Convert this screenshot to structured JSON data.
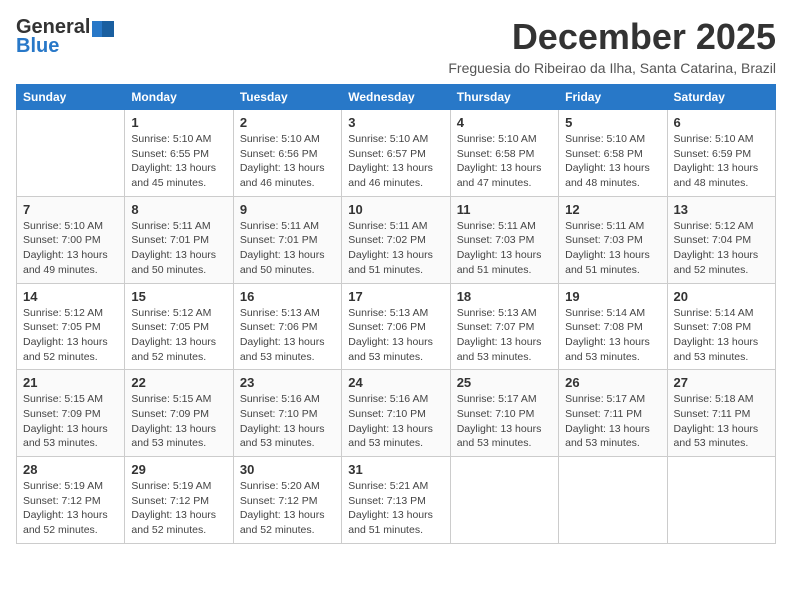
{
  "header": {
    "logo_line1": "General",
    "logo_line2": "Blue",
    "month_title": "December 2025",
    "subtitle": "Freguesia do Ribeirao da Ilha, Santa Catarina, Brazil"
  },
  "columns": [
    "Sunday",
    "Monday",
    "Tuesday",
    "Wednesday",
    "Thursday",
    "Friday",
    "Saturday"
  ],
  "weeks": [
    [
      {
        "day": "",
        "info": ""
      },
      {
        "day": "1",
        "info": "Sunrise: 5:10 AM\nSunset: 6:55 PM\nDaylight: 13 hours\nand 45 minutes."
      },
      {
        "day": "2",
        "info": "Sunrise: 5:10 AM\nSunset: 6:56 PM\nDaylight: 13 hours\nand 46 minutes."
      },
      {
        "day": "3",
        "info": "Sunrise: 5:10 AM\nSunset: 6:57 PM\nDaylight: 13 hours\nand 46 minutes."
      },
      {
        "day": "4",
        "info": "Sunrise: 5:10 AM\nSunset: 6:58 PM\nDaylight: 13 hours\nand 47 minutes."
      },
      {
        "day": "5",
        "info": "Sunrise: 5:10 AM\nSunset: 6:58 PM\nDaylight: 13 hours\nand 48 minutes."
      },
      {
        "day": "6",
        "info": "Sunrise: 5:10 AM\nSunset: 6:59 PM\nDaylight: 13 hours\nand 48 minutes."
      }
    ],
    [
      {
        "day": "7",
        "info": "Sunrise: 5:10 AM\nSunset: 7:00 PM\nDaylight: 13 hours\nand 49 minutes."
      },
      {
        "day": "8",
        "info": "Sunrise: 5:11 AM\nSunset: 7:01 PM\nDaylight: 13 hours\nand 50 minutes."
      },
      {
        "day": "9",
        "info": "Sunrise: 5:11 AM\nSunset: 7:01 PM\nDaylight: 13 hours\nand 50 minutes."
      },
      {
        "day": "10",
        "info": "Sunrise: 5:11 AM\nSunset: 7:02 PM\nDaylight: 13 hours\nand 51 minutes."
      },
      {
        "day": "11",
        "info": "Sunrise: 5:11 AM\nSunset: 7:03 PM\nDaylight: 13 hours\nand 51 minutes."
      },
      {
        "day": "12",
        "info": "Sunrise: 5:11 AM\nSunset: 7:03 PM\nDaylight: 13 hours\nand 51 minutes."
      },
      {
        "day": "13",
        "info": "Sunrise: 5:12 AM\nSunset: 7:04 PM\nDaylight: 13 hours\nand 52 minutes."
      }
    ],
    [
      {
        "day": "14",
        "info": "Sunrise: 5:12 AM\nSunset: 7:05 PM\nDaylight: 13 hours\nand 52 minutes."
      },
      {
        "day": "15",
        "info": "Sunrise: 5:12 AM\nSunset: 7:05 PM\nDaylight: 13 hours\nand 52 minutes."
      },
      {
        "day": "16",
        "info": "Sunrise: 5:13 AM\nSunset: 7:06 PM\nDaylight: 13 hours\nand 53 minutes."
      },
      {
        "day": "17",
        "info": "Sunrise: 5:13 AM\nSunset: 7:06 PM\nDaylight: 13 hours\nand 53 minutes."
      },
      {
        "day": "18",
        "info": "Sunrise: 5:13 AM\nSunset: 7:07 PM\nDaylight: 13 hours\nand 53 minutes."
      },
      {
        "day": "19",
        "info": "Sunrise: 5:14 AM\nSunset: 7:08 PM\nDaylight: 13 hours\nand 53 minutes."
      },
      {
        "day": "20",
        "info": "Sunrise: 5:14 AM\nSunset: 7:08 PM\nDaylight: 13 hours\nand 53 minutes."
      }
    ],
    [
      {
        "day": "21",
        "info": "Sunrise: 5:15 AM\nSunset: 7:09 PM\nDaylight: 13 hours\nand 53 minutes."
      },
      {
        "day": "22",
        "info": "Sunrise: 5:15 AM\nSunset: 7:09 PM\nDaylight: 13 hours\nand 53 minutes."
      },
      {
        "day": "23",
        "info": "Sunrise: 5:16 AM\nSunset: 7:10 PM\nDaylight: 13 hours\nand 53 minutes."
      },
      {
        "day": "24",
        "info": "Sunrise: 5:16 AM\nSunset: 7:10 PM\nDaylight: 13 hours\nand 53 minutes."
      },
      {
        "day": "25",
        "info": "Sunrise: 5:17 AM\nSunset: 7:10 PM\nDaylight: 13 hours\nand 53 minutes."
      },
      {
        "day": "26",
        "info": "Sunrise: 5:17 AM\nSunset: 7:11 PM\nDaylight: 13 hours\nand 53 minutes."
      },
      {
        "day": "27",
        "info": "Sunrise: 5:18 AM\nSunset: 7:11 PM\nDaylight: 13 hours\nand 53 minutes."
      }
    ],
    [
      {
        "day": "28",
        "info": "Sunrise: 5:19 AM\nSunset: 7:12 PM\nDaylight: 13 hours\nand 52 minutes."
      },
      {
        "day": "29",
        "info": "Sunrise: 5:19 AM\nSunset: 7:12 PM\nDaylight: 13 hours\nand 52 minutes."
      },
      {
        "day": "30",
        "info": "Sunrise: 5:20 AM\nSunset: 7:12 PM\nDaylight: 13 hours\nand 52 minutes."
      },
      {
        "day": "31",
        "info": "Sunrise: 5:21 AM\nSunset: 7:13 PM\nDaylight: 13 hours\nand 51 minutes."
      },
      {
        "day": "",
        "info": ""
      },
      {
        "day": "",
        "info": ""
      },
      {
        "day": "",
        "info": ""
      }
    ]
  ]
}
